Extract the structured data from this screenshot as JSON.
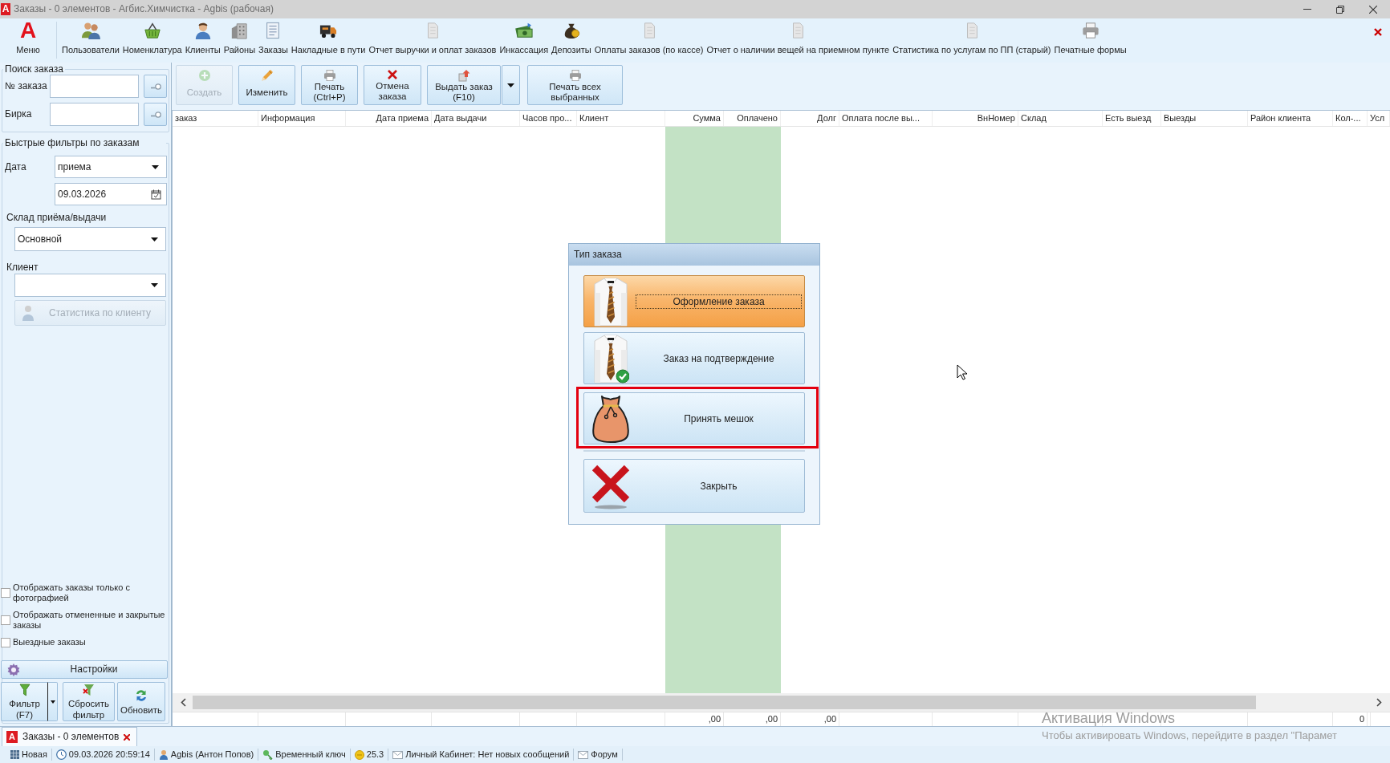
{
  "window": {
    "logo": "A",
    "title": "Заказы - 0 элементов - Агбис.Химчистка - Agbis (рабочая)"
  },
  "ribbon": {
    "menu": {
      "logo": "A",
      "label": "Меню"
    },
    "items": [
      {
        "label": "Пользователи"
      },
      {
        "label": "Номенклатура"
      },
      {
        "label": "Клиенты"
      },
      {
        "label": "Районы"
      },
      {
        "label": "Заказы"
      },
      {
        "label": "Накладные в пути"
      },
      {
        "label": "Отчет выручки и оплат заказов"
      },
      {
        "label": "Инкассация"
      },
      {
        "label": "Депозиты"
      },
      {
        "label": "Оплаты заказов (по кассе)"
      },
      {
        "label": "Отчет о наличии вещей на приемном пункте"
      },
      {
        "label": "Статистика по услугам по ПП (старый)"
      },
      {
        "label": "Печатные формы"
      }
    ]
  },
  "order_search": {
    "title": "Поиск заказа",
    "fields": [
      {
        "label": "№ заказа"
      },
      {
        "label": "Бирка"
      }
    ]
  },
  "quick_filters": {
    "title": "Быстрые фильтры по заказам",
    "date_label": "Дата",
    "date_kind": "приема",
    "date": "09.03.2026",
    "warehouse_label": "Склад приёма/выдачи",
    "warehouse": "Основной",
    "client_label": "Клиент",
    "client_stats": {
      "label": "Статистика по клиенту",
      "disabled": true
    }
  },
  "checkboxes": [
    {
      "label": "Отображать заказы только с фотографией",
      "checked": false
    },
    {
      "label": "Отображать отмененные и закрытые заказы",
      "checked": false
    },
    {
      "label": "Выездные заказы",
      "checked": false
    }
  ],
  "settings_button": {
    "label": "Настройки"
  },
  "filter_buttons": [
    {
      "label": "Фильтр\n(F7)",
      "split": true
    },
    {
      "label": "Сбросить\nфильтр",
      "split": false
    },
    {
      "label": "Обновить",
      "split": false
    }
  ],
  "toolbar": [
    {
      "label": "Создать",
      "disabled": true,
      "split": false
    },
    {
      "label": "Изменить",
      "disabled": false,
      "split": false
    },
    {
      "label": "Печать\n(Ctrl+P)",
      "disabled": false,
      "split": false
    },
    {
      "label": "Отмена\nзаказа",
      "disabled": false,
      "split": false
    },
    {
      "label": "Выдать заказ\n(F10)",
      "disabled": false,
      "split": true
    },
    {
      "label": "Печать всех\nвыбранных",
      "disabled": false,
      "split": false
    }
  ],
  "grid": {
    "columns": [
      {
        "label": "заказ",
        "highlighted": false
      },
      {
        "label": "Информация",
        "highlighted": false
      },
      {
        "label": "Дата приема",
        "highlighted": false
      },
      {
        "label": "Дата выдачи",
        "highlighted": false
      },
      {
        "label": "Часов про...",
        "highlighted": false
      },
      {
        "label": "Клиент",
        "highlighted": false
      },
      {
        "label": "Сумма",
        "highlighted": true,
        "total": ",00"
      },
      {
        "label": "Оплачено",
        "highlighted": true,
        "total": ",00"
      },
      {
        "label": "Долг",
        "highlighted": false,
        "total": ",00"
      },
      {
        "label": "Оплата после вы...",
        "highlighted": false
      },
      {
        "label": "ВнНомер",
        "highlighted": false
      },
      {
        "label": "Склад",
        "highlighted": false
      },
      {
        "label": "Есть выезд",
        "highlighted": false
      },
      {
        "label": "Выезды",
        "highlighted": false
      },
      {
        "label": "Район клиента",
        "highlighted": false
      },
      {
        "label": "Кол-...",
        "highlighted": false,
        "total": "0"
      },
      {
        "label": "Усл",
        "highlighted": false
      }
    ]
  },
  "document_tabs": [
    {
      "logo": "A",
      "label": "Заказы - 0 элементов",
      "selected": true
    }
  ],
  "status_bar": [
    {
      "text": "Новая"
    },
    {
      "text": "09.03.2026 20:59:14"
    },
    {
      "text": "Agbis (Антон Попов)"
    },
    {
      "text": "Временный ключ"
    },
    {
      "text": "25.3"
    },
    {
      "text": "Личный Кабинет: Нет новых сообщений"
    },
    {
      "text": "Форум"
    }
  ],
  "dialog": {
    "title": "Тип заказа",
    "options": [
      {
        "label": "Оформление заказа",
        "selected": true,
        "highlighted": false
      },
      {
        "label": "Заказ на подтверждение",
        "selected": false,
        "highlighted": false
      },
      {
        "label": "Принять мешок",
        "selected": false,
        "highlighted": true
      },
      {
        "label": "Закрыть",
        "selected": false,
        "highlighted": false
      }
    ]
  },
  "windows_activation": {
    "title": "Активация Windows",
    "text": "Чтобы активировать Windows, перейдите в раздел \"Парамет"
  }
}
